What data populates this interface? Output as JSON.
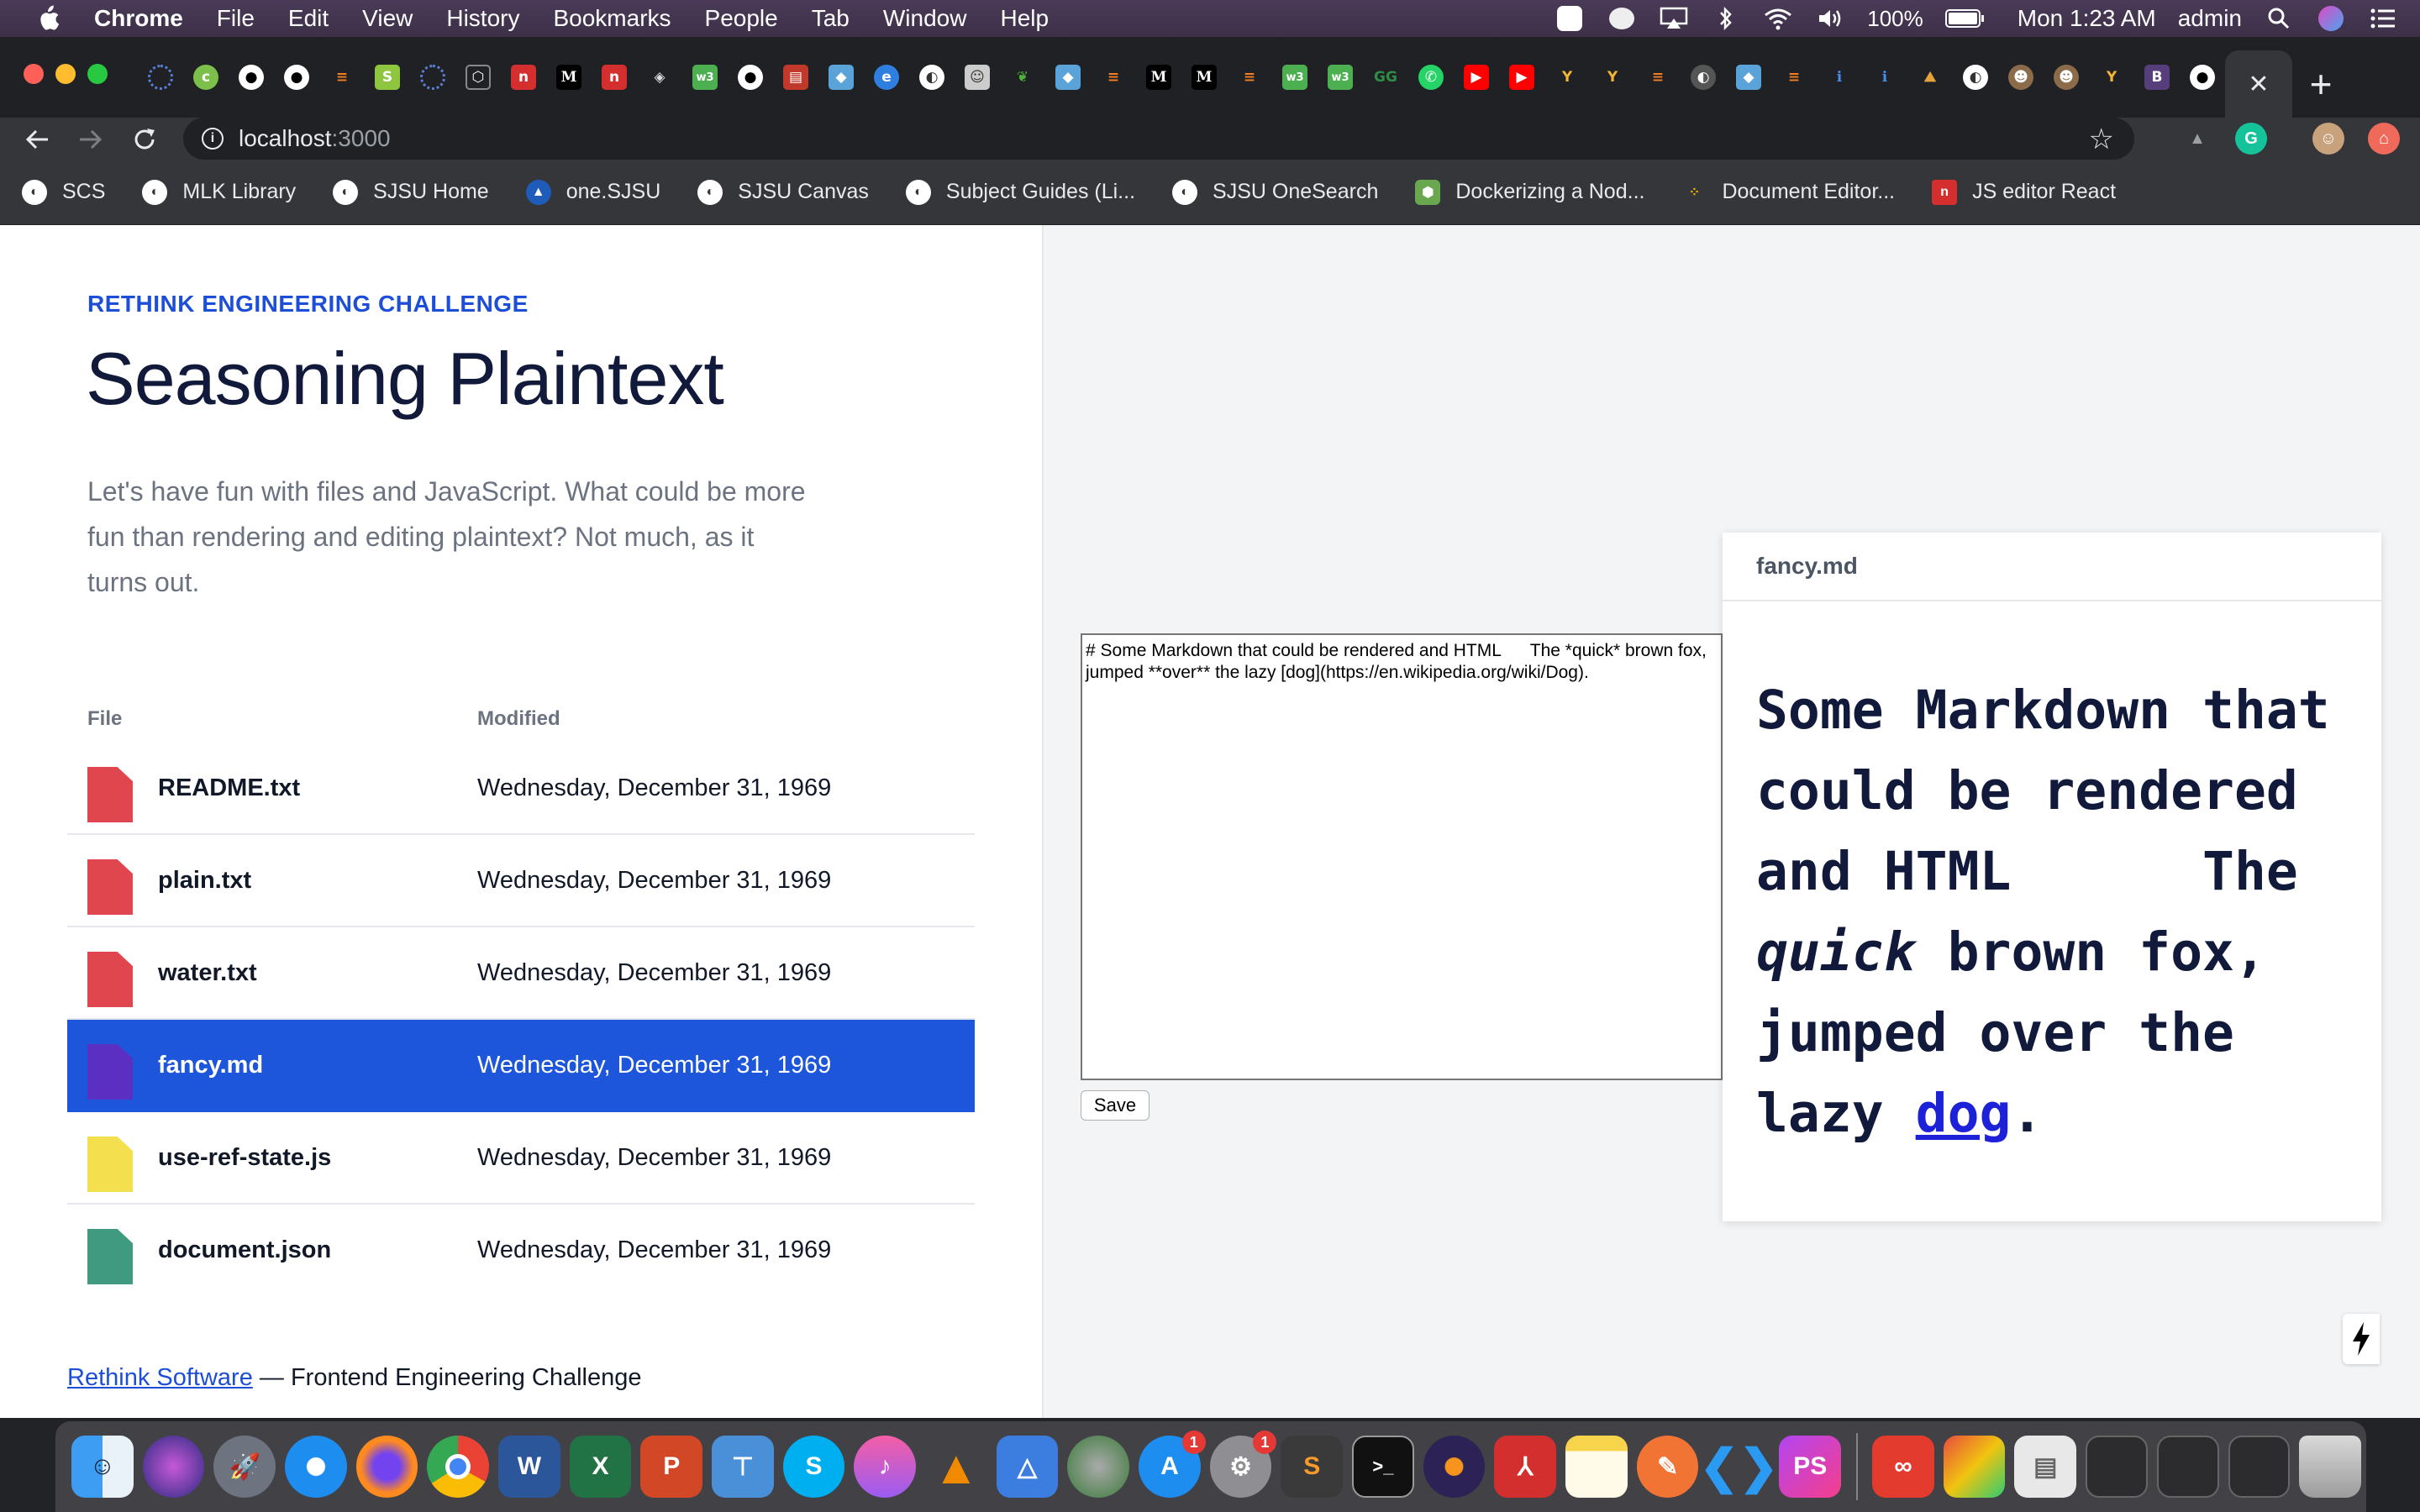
{
  "menubar": {
    "app": "Chrome",
    "items": [
      "File",
      "Edit",
      "View",
      "History",
      "Bookmarks",
      "People",
      "Tab",
      "Window",
      "Help"
    ],
    "battery": "100%",
    "clock": "Mon 1:23 AM",
    "user": "admin"
  },
  "browser": {
    "url_host": "localhost",
    "url_port": ":3000",
    "bookmarks": [
      "SCS",
      "MLK Library",
      "SJSU Home",
      "one.SJSU",
      "SJSU Canvas",
      "Subject Guides (Li...",
      "SJSU OneSearch",
      "Dockerizing a Nod...",
      "Document Editor...",
      "JS editor React"
    ]
  },
  "page": {
    "eyebrow": "RETHINK ENGINEERING CHALLENGE",
    "title": "Seasoning Plaintext",
    "lead": "Let's have fun with files and JavaScript. What could be more fun than rendering and editing plaintext? Not much, as it turns out.",
    "table_headers": {
      "file": "File",
      "modified": "Modified"
    },
    "files": [
      {
        "name": "README.txt",
        "modified": "Wednesday, December 31, 1969",
        "color": "#e0464d"
      },
      {
        "name": "plain.txt",
        "modified": "Wednesday, December 31, 1969",
        "color": "#e0464d"
      },
      {
        "name": "water.txt",
        "modified": "Wednesday, December 31, 1969",
        "color": "#e0464d"
      },
      {
        "name": "fancy.md",
        "modified": "Wednesday, December 31, 1969",
        "color": "#5b2fc2",
        "selected": true
      },
      {
        "name": "use-ref-state.js",
        "modified": "Wednesday, December 31, 1969",
        "color": "#f4df4f"
      },
      {
        "name": "document.json",
        "modified": "Wednesday, December 31, 1969",
        "color": "#3f9a80"
      }
    ],
    "footer_link": "Rethink Software",
    "footer_text": " — Frontend Engineering Challenge"
  },
  "editor": {
    "content": "# Some Markdown that could be rendered and HTML      The *quick* brown fox, jumped **over** the lazy [dog](https://en.wikipedia.org/wiki/Dog).",
    "save_label": "Save"
  },
  "preview": {
    "filename": "fancy.md",
    "text_1": "Some Markdown that could be rendered and HTML      The ",
    "emphasis": "quick",
    "text_2": " brown fox, jumped over the lazy ",
    "link": "dog",
    "text_3": "."
  }
}
